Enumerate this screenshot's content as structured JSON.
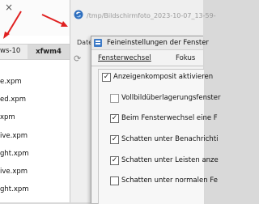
{
  "left_window": {
    "close_glyph": "×",
    "tabs": [
      "ws-10",
      "xfwm4"
    ],
    "files": [
      "e.xpm",
      "ed.xpm",
      "xpm",
      "ive.xpm",
      "ght.xpm",
      "ive.xpm",
      "ght.xpm"
    ]
  },
  "bg_window": {
    "title": "/tmp/Bildschirmfoto_2023-10-07_13-59-",
    "menu_item": "Datei",
    "icons": [
      "app-logo-icon",
      "reload-icon"
    ]
  },
  "dialog": {
    "title": "Feineinstellungen der Fenster",
    "tabs": [
      "Fensterwechsel",
      "Fokus"
    ],
    "options": [
      {
        "label": "Anzeigenkomposit aktivieren",
        "checked": true
      },
      {
        "label": "Vollbildüberlagerungsfenster",
        "checked": false
      },
      {
        "label": "Beim Fensterwechsel eine F",
        "checked": true
      },
      {
        "label": "Schatten unter Benachrichti",
        "checked": true
      },
      {
        "label": "Schatten unter Leisten anze",
        "checked": true
      },
      {
        "label": "Schatten unter normalen Fe",
        "checked": false
      }
    ]
  },
  "colors": {
    "arrow": "#e02020",
    "dialog_icon": "#3e7bc7"
  }
}
